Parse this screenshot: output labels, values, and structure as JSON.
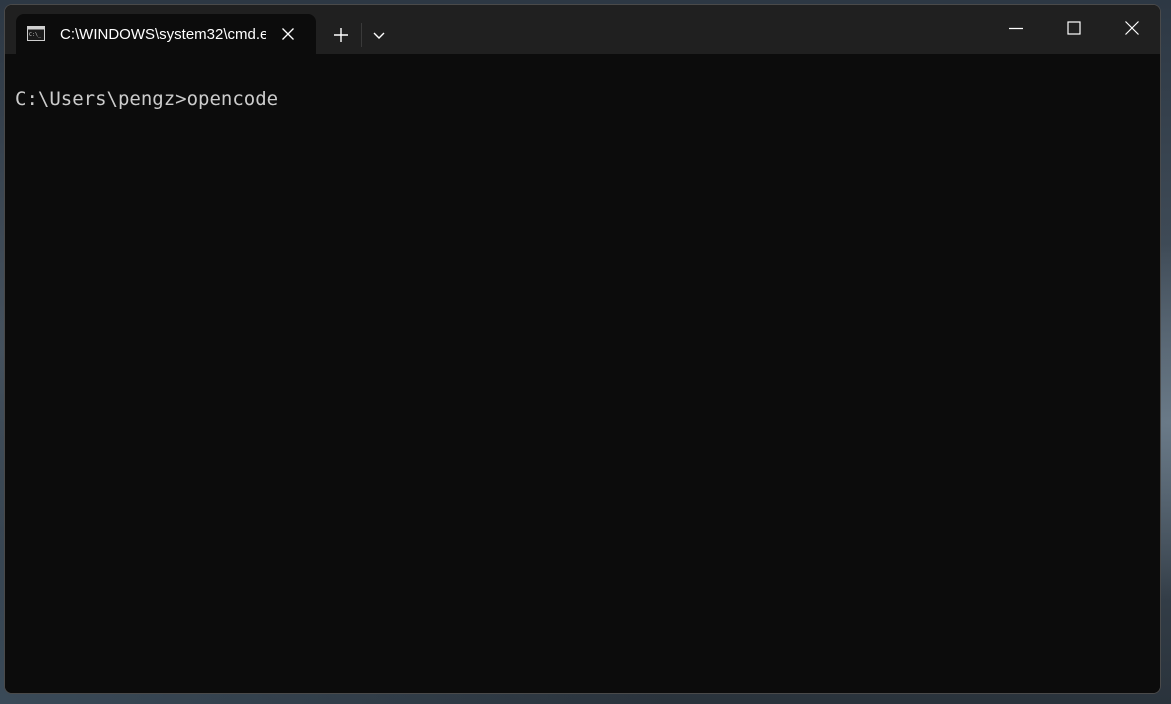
{
  "window": {
    "tab_title": "C:\\WINDOWS\\system32\\cmd.e",
    "tab_icon": "cmd-icon",
    "close_tab_icon": "close-icon",
    "new_tab_icon": "plus-icon",
    "dropdown_icon": "chevron-down-icon",
    "minimize_icon": "minimize-icon",
    "maximize_icon": "maximize-icon",
    "close_window_icon": "close-icon"
  },
  "terminal": {
    "lines": [
      "C:\\Users\\pengz>opencode"
    ]
  },
  "colors": {
    "terminal_bg": "#0c0c0c",
    "titlebar_bg": "#202020",
    "text": "#cccccc"
  }
}
